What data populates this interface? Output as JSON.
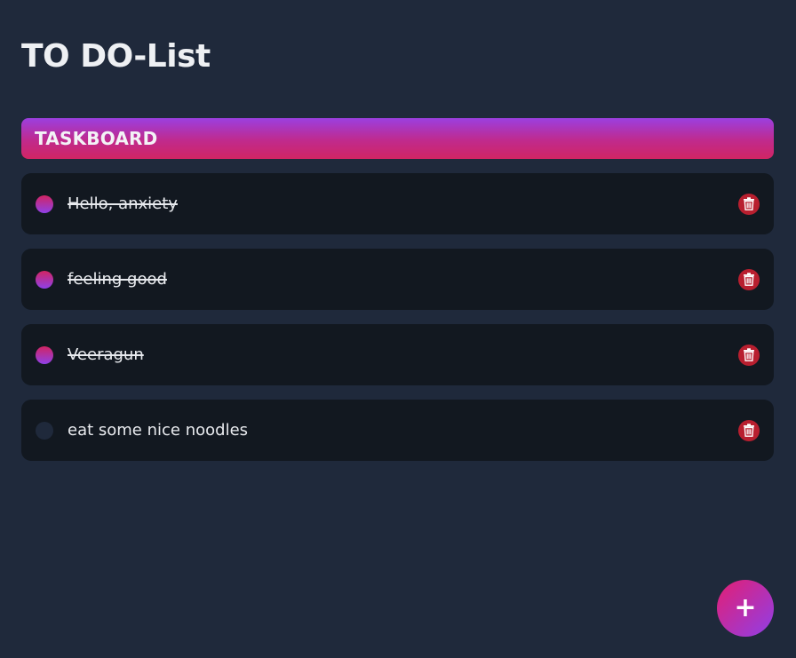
{
  "app": {
    "title": "TO DO-List"
  },
  "board": {
    "header": "TASKBOARD"
  },
  "tasks": [
    {
      "text": "Hello, anxiety",
      "completed": true
    },
    {
      "text": "feeling good",
      "completed": true
    },
    {
      "text": "Veeragun",
      "completed": true
    },
    {
      "text": "eat some nice noodles",
      "completed": false
    }
  ],
  "add_button": {
    "label": "+"
  },
  "icons": {
    "delete": "trash-icon",
    "add": "plus-icon",
    "check": "check-circle-icon"
  },
  "colors": {
    "background": "#1f293b",
    "card": "#121820",
    "accent_start": "#9b3fe0",
    "accent_end": "#d12563",
    "delete": "#b81f2f"
  }
}
